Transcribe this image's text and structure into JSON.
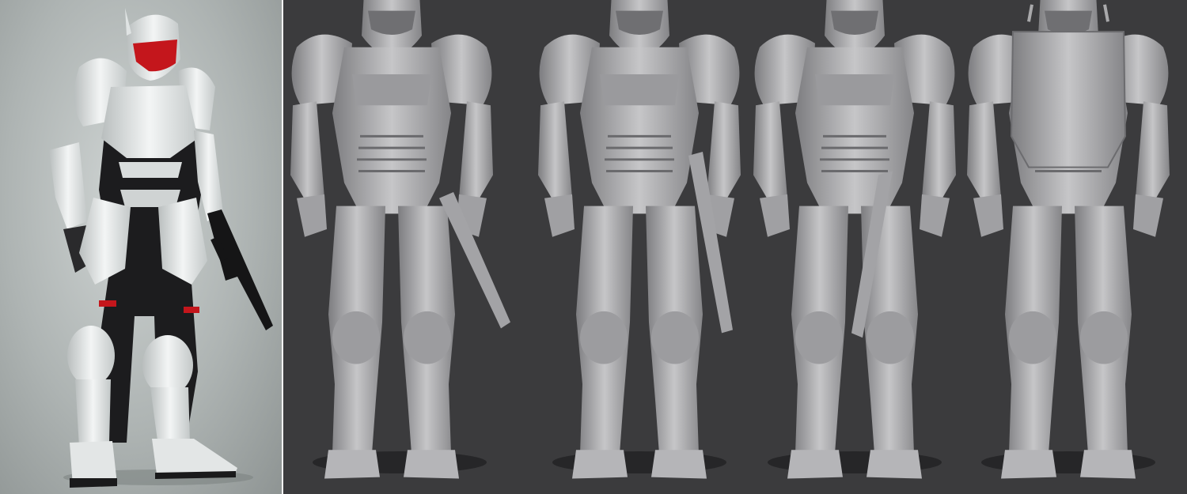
{
  "image": {
    "description_free": true,
    "panels": [
      {
        "kind": "concept-render",
        "palette": {
          "armor": "#e9ecec",
          "undersuit": "#1c1c1e",
          "visor": "#c4161c"
        }
      },
      {
        "kind": "sculpt-view-front-three-quarter-left"
      },
      {
        "kind": "sculpt-view-front"
      },
      {
        "kind": "sculpt-view-front-three-quarter-right"
      },
      {
        "kind": "sculpt-view-back"
      }
    ],
    "colors": {
      "sculpt_background": "#3b3b3d",
      "sculpt_clay": "#a9a9ab",
      "concept_background": "#b7bcbb"
    }
  }
}
